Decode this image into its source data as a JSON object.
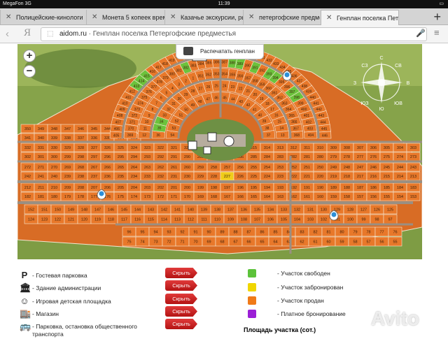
{
  "status": {
    "carrier": "MegaFon",
    "network": "3G",
    "time": "11:39"
  },
  "tabs": [
    {
      "label": "Полицейские-кинологи"
    },
    {
      "label": "Монета 5 копеек врем"
    },
    {
      "label": "Казачье экскурсии, ры"
    },
    {
      "label": "петергофские предме"
    },
    {
      "label": "Генплан поселка Петер"
    }
  ],
  "address": {
    "domain": "aidom.ru",
    "separator": " · ",
    "title": "Генплан поселка Петергофские предместья",
    "yandex": "Я"
  },
  "map": {
    "print_label": "Распечатать генплан",
    "compass": {
      "n": "С",
      "s": "Ю",
      "e": "В",
      "w": "З",
      "nw": "СЗ",
      "ne": "СВ",
      "sw": "ЮЗ",
      "se": "ЮВ"
    },
    "lot_labels": [
      "350",
      "349",
      "348",
      "347",
      "346",
      "345",
      "344",
      "343",
      "342",
      "341",
      "340",
      "339",
      "338",
      "337",
      "336",
      "335",
      "334",
      "333",
      "332",
      "331",
      "330",
      "329",
      "328",
      "327",
      "326",
      "325",
      "324",
      "323",
      "322",
      "321",
      "320",
      "319",
      "318",
      "317",
      "316",
      "315",
      "314",
      "313",
      "312",
      "311",
      "310",
      "309",
      "308",
      "307",
      "306",
      "305",
      "304",
      "303",
      "302",
      "301",
      "300",
      "299",
      "298",
      "297",
      "296",
      "295",
      "294",
      "293",
      "292",
      "291",
      "290",
      "289",
      "288",
      "287",
      "286",
      "285",
      "284",
      "283",
      "282",
      "281",
      "280",
      "279",
      "278",
      "277",
      "276",
      "275",
      "274",
      "273",
      "272",
      "271",
      "270",
      "269",
      "268",
      "267",
      "266",
      "265",
      "264",
      "263",
      "262",
      "261",
      "260",
      "259",
      "258",
      "257",
      "256",
      "255",
      "254",
      "253",
      "252",
      "251",
      "250",
      "249",
      "248",
      "247",
      "246",
      "245",
      "244",
      "243",
      "242",
      "241",
      "240",
      "239",
      "238",
      "237",
      "236",
      "235",
      "234",
      "233",
      "232",
      "231",
      "230",
      "229",
      "228",
      "227",
      "226",
      "225",
      "224",
      "223",
      "222",
      "221",
      "220",
      "219",
      "218",
      "217",
      "216",
      "215",
      "214",
      "213",
      "212",
      "211",
      "210",
      "209",
      "208",
      "207",
      "206",
      "205",
      "204",
      "203",
      "202",
      "201",
      "200",
      "199",
      "198",
      "197",
      "196",
      "195",
      "194",
      "193",
      "192",
      "191",
      "190",
      "189",
      "188",
      "187",
      "186",
      "185",
      "184",
      "183",
      "182",
      "181",
      "180",
      "179",
      "178",
      "177",
      "176",
      "175",
      "174",
      "173",
      "172",
      "171",
      "170",
      "169",
      "168",
      "167",
      "166",
      "165",
      "164",
      "163",
      "162",
      "161",
      "160",
      "159",
      "158",
      "157",
      "156",
      "155",
      "154",
      "153",
      "152",
      "151",
      "150",
      "149",
      "148",
      "147",
      "146",
      "145",
      "144",
      "143",
      "142",
      "141",
      "140",
      "139",
      "138",
      "137",
      "136",
      "135",
      "134",
      "133",
      "132",
      "131",
      "130",
      "129",
      "128",
      "127",
      "126",
      "125",
      "124",
      "123",
      "122",
      "121",
      "120",
      "119",
      "118",
      "117",
      "116",
      "115",
      "114",
      "113",
      "112",
      "111",
      "110",
      "109",
      "108",
      "107",
      "106",
      "105",
      "104",
      "103",
      "102",
      "101",
      "100",
      "99",
      "98",
      "97",
      "96",
      "95",
      "94",
      "93",
      "92",
      "91",
      "90",
      "89",
      "88",
      "87",
      "86",
      "85",
      "84",
      "83",
      "82",
      "81",
      "80",
      "79",
      "78",
      "77",
      "76",
      "75",
      "74",
      "73",
      "72",
      "71",
      "70",
      "69",
      "68",
      "67",
      "66",
      "65",
      "64",
      "63",
      "62",
      "61",
      "60",
      "59",
      "58",
      "57",
      "56",
      "55",
      "54",
      "53",
      "52",
      "51",
      "50",
      "49",
      "48",
      "47",
      "46",
      "45",
      "44",
      "43",
      "42",
      "41",
      "40",
      "39",
      "38",
      "37",
      "36",
      "35",
      "34",
      "33",
      "32",
      "31",
      "30",
      "29",
      "28",
      "27",
      "26",
      "25",
      "24",
      "23",
      "22",
      "21",
      "20",
      "19",
      "18",
      "17",
      "16",
      "15",
      "14",
      "13",
      "12",
      "11",
      "10",
      "9",
      "8",
      "7",
      "6",
      "5",
      "4",
      "3",
      "2",
      "1",
      "351",
      "352",
      "353",
      "354",
      "355",
      "356",
      "357",
      "358",
      "359",
      "360",
      "361",
      "362",
      "363",
      "364",
      "365",
      "366",
      "367",
      "368",
      "369",
      "370",
      "371",
      "372",
      "373",
      "374",
      "375",
      "376",
      "377",
      "378",
      "379",
      "380",
      "381",
      "382",
      "383",
      "384",
      "385",
      "386",
      "387",
      "388",
      "389",
      "390",
      "391",
      "392",
      "393",
      "394",
      "395",
      "396",
      "397",
      "398",
      "399",
      "400",
      "401",
      "402",
      "403",
      "404",
      "405",
      "406",
      "407",
      "408",
      "409",
      "410",
      "411",
      "412",
      "413",
      "414",
      "415",
      "416",
      "417",
      "418",
      "419",
      "420",
      "421",
      "422",
      "423",
      "424",
      "425",
      "426",
      "427",
      "428",
      "429",
      "430",
      "431",
      "432",
      "433",
      "434",
      "435",
      "436",
      "437",
      "438",
      "439",
      "440",
      "441",
      "442",
      "443",
      "444",
      "445",
      "446",
      "447",
      "448",
      "449",
      "450"
    ],
    "free_lots": [
      "382",
      "397",
      "398",
      "389",
      "388",
      "394",
      "393",
      "391",
      "413",
      "414",
      "415",
      "423",
      "34",
      "35"
    ],
    "reserved_lots": [
      "227"
    ]
  },
  "legend": {
    "left": [
      {
        "symbol": "P",
        "icon": "parking-icon",
        "label": "- Гостевая парковка"
      },
      {
        "symbol": "🏛",
        "icon": "admin-building-icon",
        "label": "- Здание администрации"
      },
      {
        "symbol": "☺",
        "icon": "playground-icon",
        "label": "- Игровая детская площадка"
      },
      {
        "symbol": "🏬",
        "icon": "shop-icon",
        "label": "- Магазин"
      },
      {
        "symbol": "🚌",
        "icon": "bus-icon",
        "label": "- Парковка, остановка общественного"
      },
      {
        "symbol": "",
        "icon": "",
        "label": "транспорта"
      }
    ],
    "hide_label": "Скрыть",
    "statuses": [
      {
        "color": "#5cc23a",
        "label": "- Участок свободен"
      },
      {
        "color": "#f0d600",
        "label": "- Участок забронирован"
      },
      {
        "color": "#f07a18",
        "label": "- Участок продан"
      },
      {
        "color": "#9b1fd6",
        "label": "- Платное бронирование"
      }
    ],
    "area_title": "Площадь участка (сот.)"
  },
  "watermark": "Avito"
}
